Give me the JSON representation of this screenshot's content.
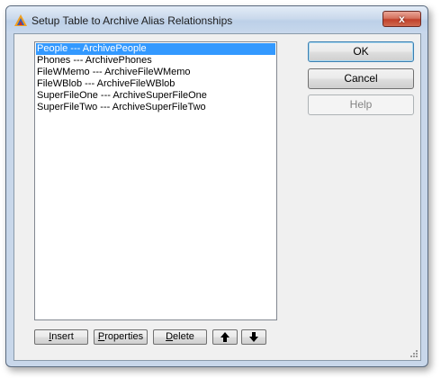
{
  "window": {
    "title": "Setup Table to Archive Alias Relationships",
    "close_glyph": "x"
  },
  "list": {
    "items": [
      "People --- ArchivePeople",
      "Phones --- ArchivePhones",
      "FileWMemo --- ArchiveFileWMemo",
      "FileWBlob --- ArchiveFileWBlob",
      "SuperFileOne --- ArchiveSuperFileOne",
      "SuperFileTwo --- ArchiveSuperFileTwo"
    ],
    "selected_index": 0
  },
  "buttons": {
    "ok": "OK",
    "cancel": "Cancel",
    "help": "Help",
    "insert_mnemonic": "I",
    "insert_rest": "nsert",
    "properties_mnemonic": "P",
    "properties_rest": "roperties",
    "delete_mnemonic": "D",
    "delete_rest": "elete"
  },
  "icons": {
    "app": "app-triangle-icon",
    "move_up": "arrow-up-icon",
    "move_down": "arrow-down-icon"
  },
  "colors": {
    "selection": "#3399ff",
    "close_button": "#c0402a"
  }
}
